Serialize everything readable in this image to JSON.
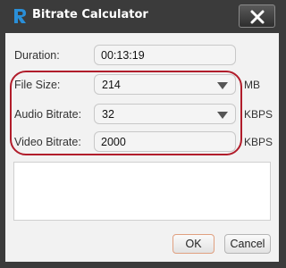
{
  "window": {
    "title": "Bitrate Calculator"
  },
  "form": {
    "duration": {
      "label": "Duration:",
      "value": "00:13:19"
    },
    "file_size": {
      "label": "File Size:",
      "value": "214",
      "unit": "MB"
    },
    "audio_bitrate": {
      "label": "Audio Bitrate:",
      "value": "32",
      "unit": "KBPS"
    },
    "video_bitrate": {
      "label": "Video Bitrate:",
      "value": "2000",
      "unit": "KBPS"
    }
  },
  "buttons": {
    "ok": "OK",
    "cancel": "Cancel"
  },
  "colors": {
    "title_bar": "#3b3b3b",
    "highlight": "#b11d2b",
    "app_icon": "#2a8fd8"
  }
}
